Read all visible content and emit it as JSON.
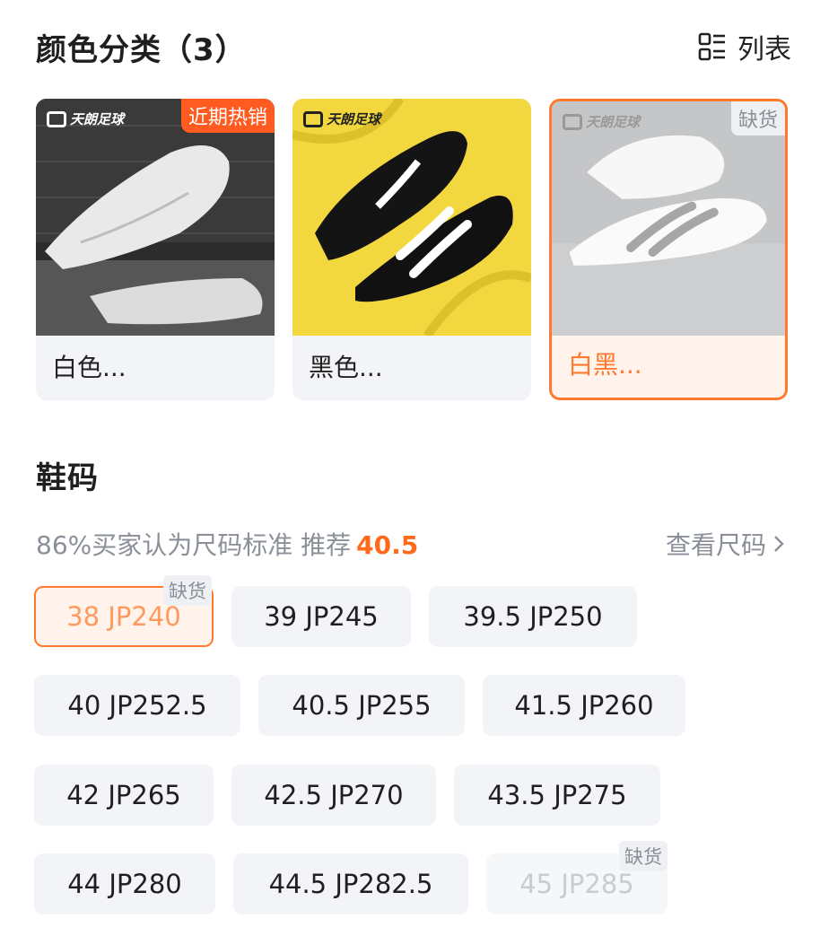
{
  "colors": {
    "title": "颜色分类（3）",
    "list_toggle_label": "列表",
    "accent": "#ff7a2e",
    "items": [
      {
        "label": "白色...",
        "watermark": "天朗足球",
        "badge": "近期热销"
      },
      {
        "label": "黑色...",
        "watermark": "天朗足球"
      },
      {
        "label": "白黑...",
        "watermark": "天朗足球",
        "badge": "缺货"
      }
    ]
  },
  "sizes": {
    "title": "鞋码",
    "fit_text": "86%买家认为尺码标准 推荐",
    "recommended": "40.5",
    "guide_link": "查看尺码",
    "items": [
      {
        "label": "38 JP240",
        "tag": "缺货"
      },
      {
        "label": "39 JP245"
      },
      {
        "label": "39.5 JP250"
      },
      {
        "label": "40 JP252.5"
      },
      {
        "label": "40.5 JP255"
      },
      {
        "label": "41.5 JP260"
      },
      {
        "label": "42 JP265"
      },
      {
        "label": "42.5 JP270"
      },
      {
        "label": "43.5 JP275"
      },
      {
        "label": "44 JP280"
      },
      {
        "label": "44.5 JP282.5"
      },
      {
        "label": "45 JP285",
        "tag": "缺货"
      }
    ]
  }
}
